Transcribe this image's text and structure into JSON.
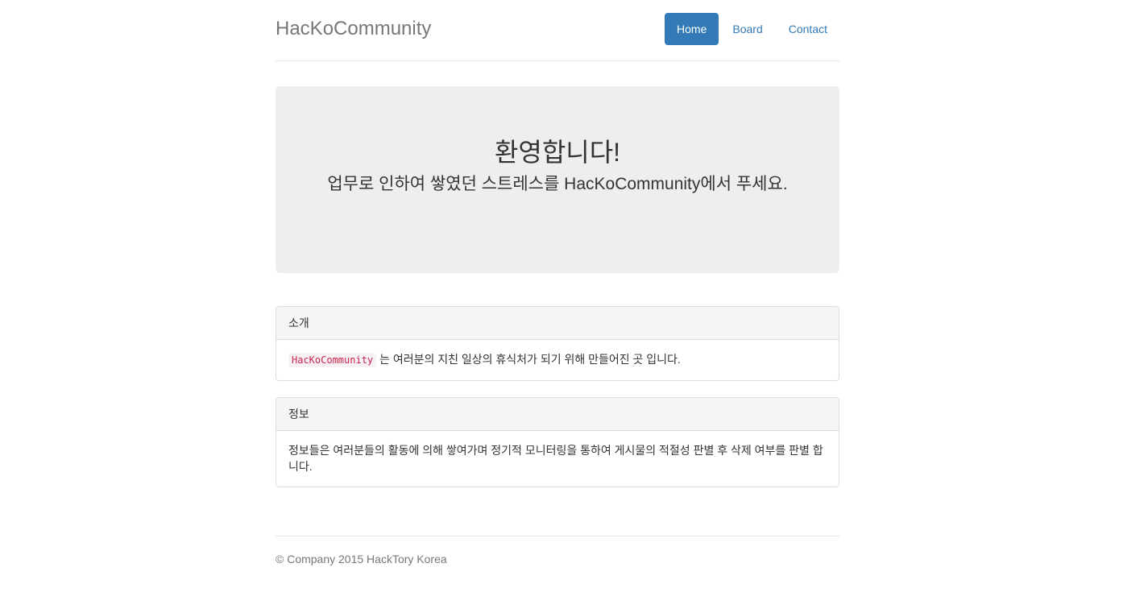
{
  "header": {
    "brand": "HacKoCommunity",
    "nav": {
      "home": "Home",
      "board": "Board",
      "contact": "Contact"
    },
    "active_nav": "Home",
    "accent_color": "#337ab7"
  },
  "jumbotron": {
    "title": "환영합니다!",
    "subtitle": "업무로 인하여 쌓였던 스트레스를 HacKoCommunity에서 푸세요."
  },
  "panels": {
    "intro": {
      "heading": "소개",
      "code": "HacKoCommunity",
      "text": " 는 여러분의 지친 일상의 휴식처가 되기 위해 만들어진 곳 입니다."
    },
    "info": {
      "heading": "정보",
      "text": "정보들은 여러분들의 활동에 의해 쌓여가며 정기적 모니터링을 통하여 게시물의 적절성 판별 후 삭제 여부를 판별 합니다."
    }
  },
  "footer": {
    "text": "© Company 2015 HackTory Korea"
  }
}
